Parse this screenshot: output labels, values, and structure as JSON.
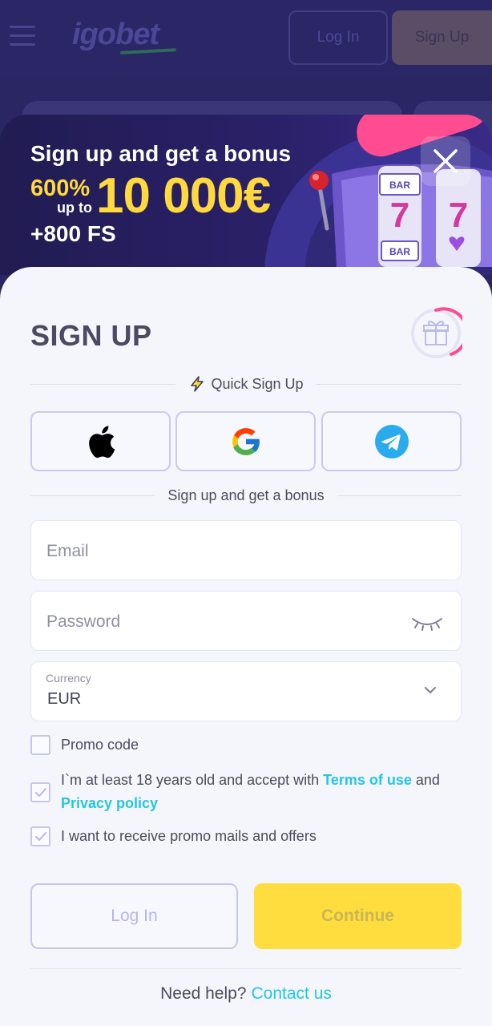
{
  "header": {
    "logo_text": "igobet",
    "login_label": "Log In",
    "signup_label": "Sign Up"
  },
  "promo": {
    "title": "Sign up and get a bonus",
    "percent": "600%",
    "up_to": "up to",
    "amount": "10 000€",
    "free_spins": "+800 FS"
  },
  "form": {
    "title": "SIGN UP",
    "quick_signup": "Quick Sign Up",
    "bonus_divider": "Sign up and get a bonus",
    "email_placeholder": "Email",
    "password_placeholder": "Password",
    "currency_label": "Currency",
    "currency_value": "EUR",
    "promo_code": "Promo code",
    "terms_text_1": "I`m at least 18 years old and accept with ",
    "terms_link": "Terms of use",
    "terms_text_2": " and",
    "privacy_link": "Privacy policy",
    "promo_mails": "I want to receive promo mails and offers",
    "login_button": "Log In",
    "continue_button": "Continue",
    "help_text": "Need help?",
    "contact_link": "Contact us"
  },
  "checkboxes": {
    "promo_code_checked": false,
    "terms_checked": true,
    "promo_mails_checked": true
  },
  "colors": {
    "accent_yellow": "#ffdd3e",
    "link_cyan": "#24c6e0",
    "banner_bg": "#2a2068",
    "pink": "#ff4b8f"
  },
  "icons": {
    "social": [
      "apple-icon",
      "google-icon",
      "telegram-icon"
    ]
  }
}
